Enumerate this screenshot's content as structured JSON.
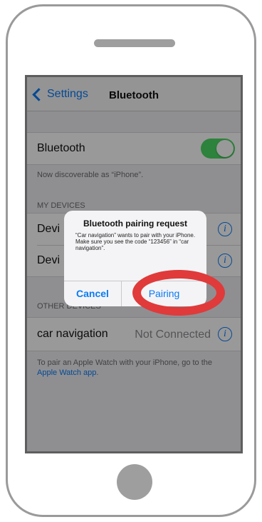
{
  "nav": {
    "back_label": "Settings",
    "title": "Bluetooth"
  },
  "bluetooth": {
    "label": "Bluetooth",
    "enabled": true,
    "discoverable_text": "Now discoverable as “iPhone”."
  },
  "my_devices": {
    "header": "MY DEVICES",
    "items": [
      {
        "label": "Devi"
      },
      {
        "label": "Devi"
      }
    ]
  },
  "other_devices": {
    "header": "OTHER DEVICES",
    "items": [
      {
        "label": "car navigation",
        "status": "Not Connected"
      }
    ]
  },
  "footer": {
    "text": "To pair an Apple Watch with your iPhone, go to the",
    "link": "Apple Watch app",
    "suffix": "."
  },
  "alert": {
    "title": "Bluetooth pairing request",
    "message_line1": "“Car navigation” wants to pair with your iPhone.",
    "message_line2": "Make sure you see the code “123456” in “car navigation”.",
    "cancel_label": "Cancel",
    "confirm_label": "Pairing"
  },
  "colors": {
    "accent": "#0a7bf5",
    "toggle_on": "#4cd964",
    "highlight": "#e03a3a"
  }
}
